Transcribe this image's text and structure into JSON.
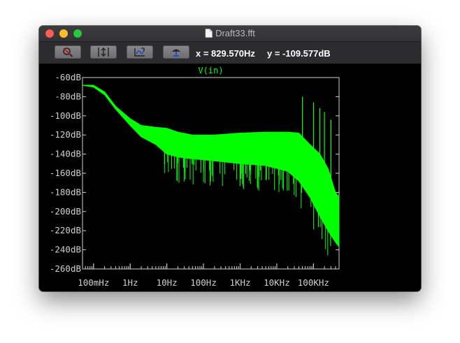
{
  "window": {
    "title": "Draft33.fft"
  },
  "toolbar": {
    "buttons": [
      {
        "icon": "zoom-cancel-icon"
      },
      {
        "icon": "autorange-vertical-icon"
      },
      {
        "icon": "autorange-horizontal-icon"
      },
      {
        "icon": "paste-marker-icon"
      }
    ],
    "cursor_x": "x = 829.570Hz",
    "cursor_y": "y = -109.577dB"
  },
  "chart_data": {
    "type": "line",
    "trace_name": "V(in)",
    "trace_color": "#00ff00",
    "background": "#000000",
    "axis_color": "#cfcfcf",
    "x_scale": "log",
    "xlim_hz": [
      0.05,
      500000
    ],
    "ylim_db": [
      -260,
      -60
    ],
    "x_ticks": [
      {
        "value": 0.1,
        "label": "100mHz"
      },
      {
        "value": 1,
        "label": "1Hz"
      },
      {
        "value": 10,
        "label": "10Hz"
      },
      {
        "value": 100,
        "label": "100Hz"
      },
      {
        "value": 1000,
        "label": "1KHz"
      },
      {
        "value": 10000,
        "label": "10KHz"
      },
      {
        "value": 100000,
        "label": "100KHz"
      }
    ],
    "y_ticks": [
      {
        "value": -60,
        "label": "-60dB"
      },
      {
        "value": -80,
        "label": "-80dB"
      },
      {
        "value": -100,
        "label": "-100dB"
      },
      {
        "value": -120,
        "label": "-120dB"
      },
      {
        "value": -140,
        "label": "-140dB"
      },
      {
        "value": -160,
        "label": "-160dB"
      },
      {
        "value": -180,
        "label": "-180dB"
      },
      {
        "value": -200,
        "label": "-200dB"
      },
      {
        "value": -220,
        "label": "-220dB"
      },
      {
        "value": -240,
        "label": "-240dB"
      },
      {
        "value": -260,
        "label": "-260dB"
      }
    ],
    "envelope": [
      {
        "x": 0.05,
        "top": -68,
        "bottom": -68
      },
      {
        "x": 0.1,
        "top": -68,
        "bottom": -70
      },
      {
        "x": 0.2,
        "top": -75,
        "bottom": -78
      },
      {
        "x": 0.4,
        "top": -90,
        "bottom": -93
      },
      {
        "x": 1,
        "top": -103,
        "bottom": -110
      },
      {
        "x": 2,
        "top": -110,
        "bottom": -122
      },
      {
        "x": 5,
        "top": -112,
        "bottom": -130
      },
      {
        "x": 10,
        "top": -113,
        "bottom": -140
      },
      {
        "x": 20,
        "top": -117,
        "bottom": -143
      },
      {
        "x": 50,
        "top": -120,
        "bottom": -145
      },
      {
        "x": 200,
        "top": -120,
        "bottom": -147
      },
      {
        "x": 1000,
        "top": -118,
        "bottom": -150
      },
      {
        "x": 5000,
        "top": -117,
        "bottom": -152
      },
      {
        "x": 20000,
        "top": -117,
        "bottom": -158
      },
      {
        "x": 40000,
        "top": -118,
        "bottom": -168
      },
      {
        "x": 80000,
        "top": -130,
        "bottom": -185
      },
      {
        "x": 150000,
        "top": -140,
        "bottom": -205
      },
      {
        "x": 250000,
        "top": -155,
        "bottom": -220
      },
      {
        "x": 400000,
        "top": -180,
        "bottom": -232
      },
      {
        "x": 500000,
        "top": -185,
        "bottom": -237
      }
    ],
    "spurs": [
      {
        "x": 50000,
        "top": -80
      },
      {
        "x": 100000,
        "top": -86
      },
      {
        "x": 150000,
        "top": -92
      },
      {
        "x": 200000,
        "top": -96
      },
      {
        "x": 300000,
        "top": -104
      }
    ]
  }
}
